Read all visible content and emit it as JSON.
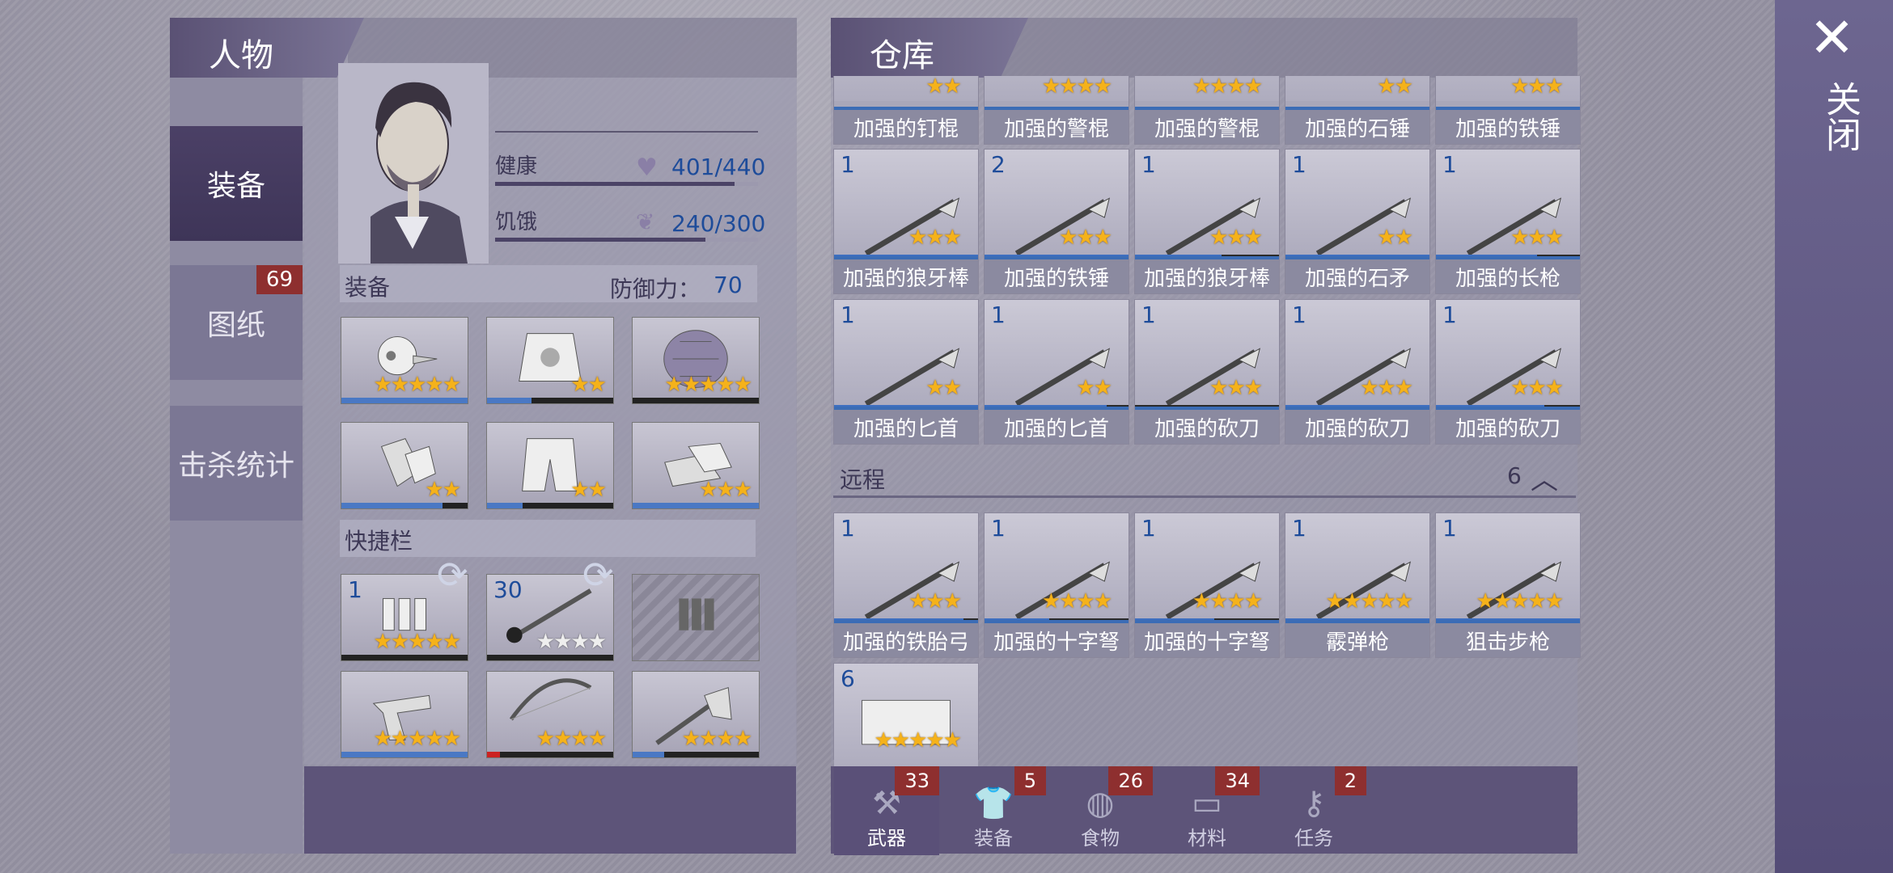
{
  "character_panel": {
    "title": "人物",
    "tabs": [
      {
        "label": "装备"
      },
      {
        "label": "图纸",
        "badge": "69"
      },
      {
        "label": "击杀统计"
      }
    ],
    "health": {
      "label": "健康",
      "value": "401/440",
      "fill": 0.91
    },
    "hunger": {
      "label": "饥饿",
      "value": "240/300",
      "fill": 0.8
    },
    "equipment_label": "装备",
    "defense_label": "防御力：",
    "defense_value": "70",
    "equipment": [
      {
        "icon": "chicken-helmet-icon",
        "stars": "★★★★★",
        "fill": 1
      },
      {
        "icon": "armor-vest-icon",
        "stars": "★★",
        "fill": 0.35
      },
      {
        "icon": "turtle-shell-icon",
        "stars": "★★★★★",
        "fill": 0
      },
      {
        "icon": "gloves-icon",
        "stars": "★★",
        "fill": 0.8
      },
      {
        "icon": "pants-icon",
        "stars": "★★",
        "fill": 0.28
      },
      {
        "icon": "sneakers-icon",
        "stars": "★★★",
        "fill": 1
      }
    ],
    "quickbar_label": "快捷栏",
    "quickbar": [
      {
        "icon": "bullets-icon",
        "count": "1",
        "stars": "★★★★★",
        "fill": 0
      },
      {
        "icon": "poison-spear-icon",
        "count": "30",
        "stars": "★★★★",
        "fill": 0
      },
      {
        "icon": "locked-slot-icon",
        "count": "",
        "stars": "",
        "fill": 0
      },
      {
        "icon": "revolver-icon",
        "count": "",
        "stars": "★★★★★",
        "fill": 1
      },
      {
        "icon": "bow-icon",
        "count": "",
        "stars": "★★★★",
        "fill": 0.1
      },
      {
        "icon": "axe-icon",
        "count": "",
        "stars": "★★★★",
        "fill": 0.25
      }
    ]
  },
  "warehouse": {
    "title": "仓库",
    "top_row": [
      {
        "name": "加强的钉棍",
        "stars": "★★"
      },
      {
        "name": "加强的警棍",
        "stars": "★★★★"
      },
      {
        "name": "加强的警棍",
        "stars": "★★★★"
      },
      {
        "name": "加强的石锤",
        "stars": "★★"
      },
      {
        "name": "加强的铁锤",
        "stars": "★★★"
      }
    ],
    "melee": [
      {
        "count": "1",
        "name": "加强的狼牙棒",
        "stars": "★★★",
        "fill": 1
      },
      {
        "count": "2",
        "name": "加强的铁锤",
        "stars": "★★★",
        "fill": 1
      },
      {
        "count": "1",
        "name": "加强的狼牙棒",
        "stars": "★★★",
        "fill": 0.6
      },
      {
        "count": "1",
        "name": "加强的石矛",
        "stars": "★★",
        "fill": 1
      },
      {
        "count": "1",
        "name": "加强的长枪",
        "stars": "★★★",
        "fill": 0.7
      },
      {
        "count": "1",
        "name": "加强的匕首",
        "stars": "★★",
        "fill": 1
      },
      {
        "count": "1",
        "name": "加强的匕首",
        "stars": "★★",
        "fill": 0.85
      },
      {
        "count": "1",
        "name": "加强的砍刀",
        "stars": "★★★",
        "fill": 0
      },
      {
        "count": "1",
        "name": "加强的砍刀",
        "stars": "★★★",
        "fill": 1
      },
      {
        "count": "1",
        "name": "加强的砍刀",
        "stars": "★★★",
        "fill": 0.75
      }
    ],
    "ranged_label": "远程",
    "ranged_count": "6",
    "ranged": [
      {
        "count": "1",
        "name": "加强的铁胎弓",
        "stars": "★★★",
        "fill": 0.9
      },
      {
        "count": "1",
        "name": "加强的十字弩",
        "stars": "★★★★",
        "fill": 0.45
      },
      {
        "count": "1",
        "name": "加强的十字弩",
        "stars": "★★★★",
        "fill": 0.55
      },
      {
        "count": "1",
        "name": "霰弹枪",
        "stars": "★★★★★",
        "fill": 1
      },
      {
        "count": "1",
        "name": "狙击步枪",
        "stars": "★★★★★",
        "fill": 1
      },
      {
        "count": "6",
        "name": "",
        "stars": "★★★★★",
        "fill": 0
      }
    ],
    "bottom_tabs": [
      {
        "label": "武器",
        "badge": "33"
      },
      {
        "label": "装备",
        "badge": "5"
      },
      {
        "label": "食物",
        "badge": "26"
      },
      {
        "label": "材料",
        "badge": "34"
      },
      {
        "label": "任务",
        "badge": "2"
      }
    ]
  },
  "close_label": "关闭",
  "colors": {
    "accent": "#4a78c4",
    "badge": "#8e2f2f",
    "star": "#f5b21a"
  }
}
